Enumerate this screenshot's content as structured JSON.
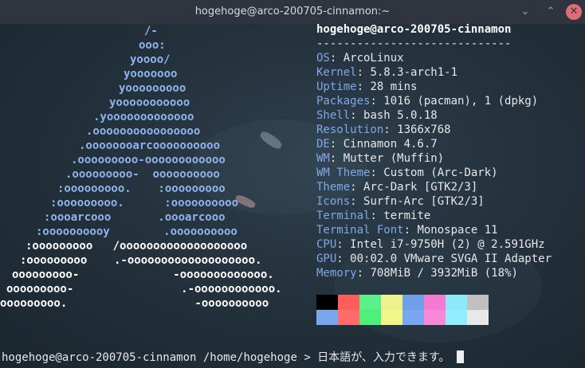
{
  "window": {
    "title": "hogehoge@arco-200705-cinnamon:~",
    "minimize_glyph": "⌄",
    "maximize_glyph": "⌃",
    "close_glyph": "✕"
  },
  "logo": {
    "lines": [
      "/-",
      "ooo:",
      "yoooo/",
      "yooooooo",
      "yooooooooo",
      "yooooooooooo",
      ".yooooooooooooo",
      ".oooooooooooooooo",
      ".oooooooarcoooooooooo",
      ".ooooooooo-oooooooooooo",
      ".ooooooooo-  oooooooooo",
      ":ooooooooo.    :ooooooooo",
      ":ooooooooo.      :oooooooooo",
      ":oooarcooo       .oooarcooo",
      ":oooooooooy        .oooooooooo",
      ":ooooooooo   /ooooooooooooooooooo",
      ":ooooooooo    .-ooooooooooooooooooo.",
      "ooooooooo-              -ooooooooooooo.",
      "ooooooooo-                .-oooooooooooo.",
      "ooooooooo.                   -oooooooooo"
    ],
    "color": "#8fb4ee",
    "highlight_color": "#ffffff"
  },
  "info": {
    "user_host": "hogehoge@arco-200705-cinnamon",
    "separator": "-----------------------------",
    "rows": [
      {
        "key": "OS",
        "value": "ArcoLinux"
      },
      {
        "key": "Kernel",
        "value": "5.8.3-arch1-1"
      },
      {
        "key": "Uptime",
        "value": "28 mins"
      },
      {
        "key": "Packages",
        "value": "1016 (pacman), 1 (dpkg)"
      },
      {
        "key": "Shell",
        "value": "bash 5.0.18"
      },
      {
        "key": "Resolution",
        "value": "1366x768"
      },
      {
        "key": "DE",
        "value": "Cinnamon 4.6.7"
      },
      {
        "key": "WM",
        "value": "Mutter (Muffin)"
      },
      {
        "key": "WM Theme",
        "value": "Custom (Arc-Dark)"
      },
      {
        "key": "Theme",
        "value": "Arc-Dark [GTK2/3]"
      },
      {
        "key": "Icons",
        "value": "Surfn-Arc [GTK2/3]"
      },
      {
        "key": "Terminal",
        "value": "termite"
      },
      {
        "key": "Terminal Font",
        "value": "Monospace 11"
      },
      {
        "key": "CPU",
        "value": "Intel i7-9750H (2) @ 2.591GHz"
      },
      {
        "key": "GPU",
        "value": "00:02.0 VMware SVGA II Adapter"
      },
      {
        "key": "Memory",
        "value": "708MiB / 3932MiB (18%)"
      }
    ],
    "palette_top": [
      "#000000",
      "#ff5c5c",
      "#5cf08a",
      "#eef28e",
      "#6f9fe8",
      "#f57ad1",
      "#8de9f7",
      "#c0c0c0"
    ],
    "palette_bottom": [
      "#7aa6f0",
      "#ff6b6b",
      "#4ff07a",
      "#f2f58a",
      "#7aa6f0",
      "#f78ad6",
      "#93ecff",
      "#e8e8e8"
    ]
  },
  "prompt": {
    "user_host": "hogehoge@arco-200705-cinnamon",
    "path": "/home/hogehoge",
    "symbol": ">",
    "input": "日本語が、入力できます。"
  }
}
